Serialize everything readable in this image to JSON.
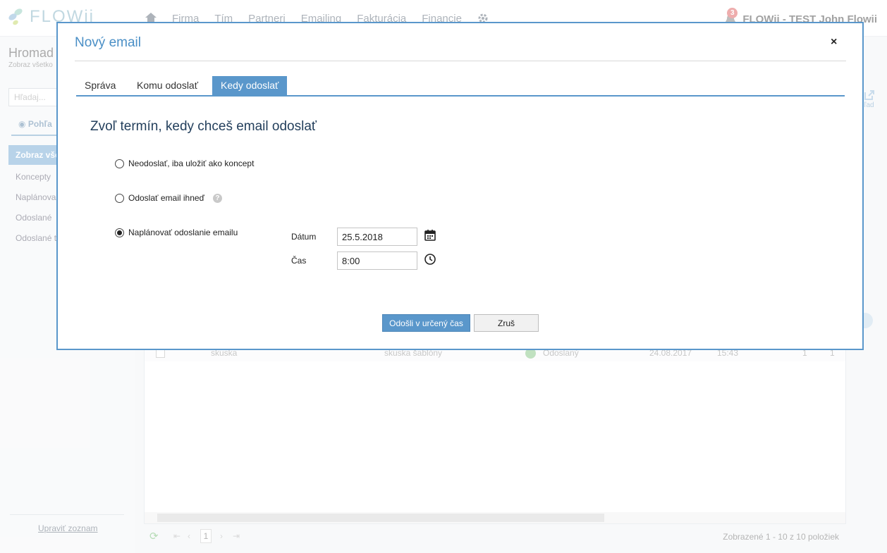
{
  "app": {
    "logo_text": "FLOWii",
    "nav": [
      "Firma",
      "Tím",
      "Partneri",
      "Emailing",
      "Fakturácia",
      "Financie"
    ],
    "notification_count": "3",
    "user": "FLOWii - TEST  John Flowii"
  },
  "sidebar": {
    "title": "Hromad",
    "subtitle": "Zobraz všetko",
    "search_placeholder": "Hľadaj...",
    "view_label": "Pohľa",
    "items": [
      {
        "label": "Zobraz vše"
      },
      {
        "label": "Koncepty"
      },
      {
        "label": "Naplánova"
      },
      {
        "label": "Odoslané"
      },
      {
        "label": "Odoslané t"
      }
    ],
    "edit_link": "Upraviť zoznam"
  },
  "table": {
    "row": {
      "name": "skuska",
      "template": "skuska šablóny",
      "status": "Odoslaný",
      "date": "24.08.2017",
      "time": "15:43",
      "count1": "1",
      "count2": "1"
    },
    "page": "1",
    "info": "Zobrazené 1 - 10 z 10 položiek",
    "right_link": "hľad"
  },
  "modal": {
    "title": "Nový email",
    "close": "×",
    "tabs": [
      {
        "label": "Správa"
      },
      {
        "label": "Komu odoslať"
      },
      {
        "label": "Kedy odoslať"
      }
    ],
    "active_tab": "Kedy odoslať",
    "heading": "Zvoľ termín, kedy chceš email odoslať",
    "options": [
      {
        "label": "Neodoslať, iba uložiť ako koncept",
        "checked": false
      },
      {
        "label": "Odoslať email ihneď",
        "checked": false,
        "help": "?"
      },
      {
        "label": "Naplánovať odoslanie emailu",
        "checked": true
      }
    ],
    "date_label": "Dátum",
    "date_value": "25.5.2018",
    "time_label": "Čas",
    "time_value": "8:00",
    "submit_label": "Odošli v určený čas",
    "cancel_label": "Zruš"
  },
  "colors": {
    "accent": "#5a97cb",
    "heading": "#233f5c",
    "status_ok": "#8cc98c",
    "badge": "#e06a6a"
  },
  "icons": [
    "home-icon",
    "gear-icon",
    "bell-icon",
    "eye-icon",
    "calendar-icon",
    "clock-icon",
    "help-icon",
    "external-link-icon",
    "refresh-icon"
  ]
}
